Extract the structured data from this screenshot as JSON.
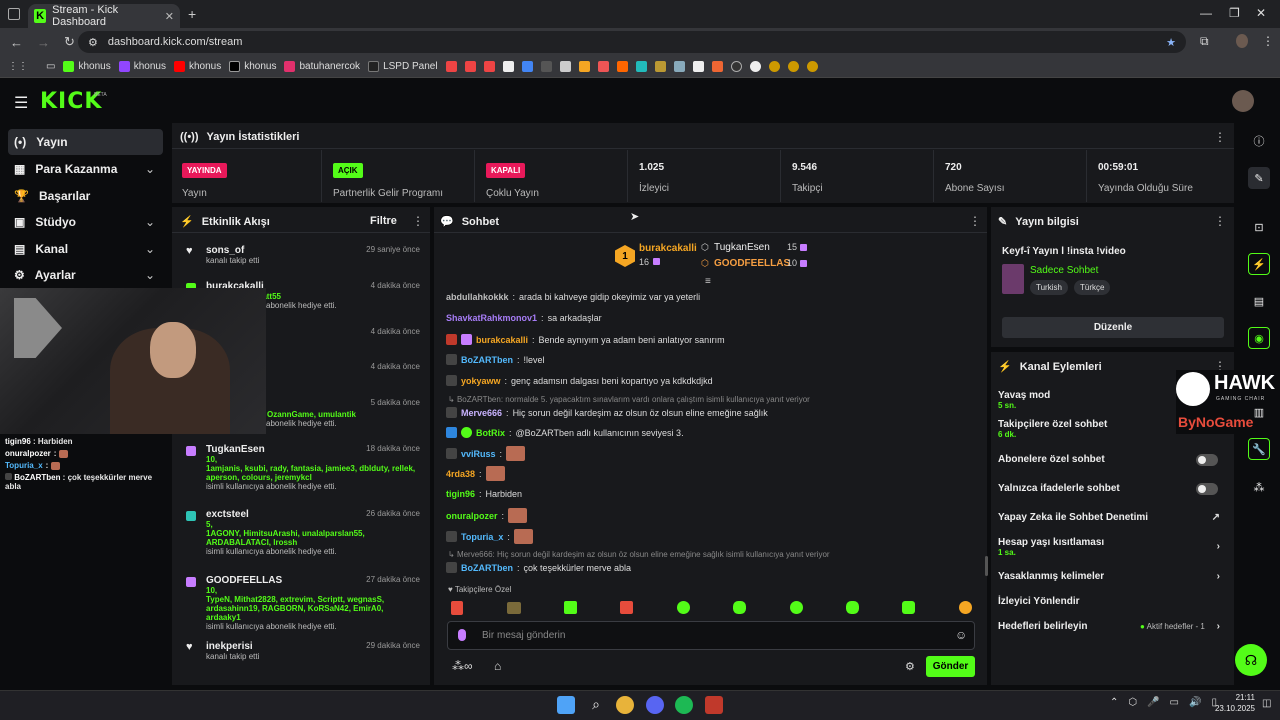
{
  "browser": {
    "tab_title": "Stream - Kick Dashboard",
    "tab_close": "✕",
    "new_tab": "+",
    "url": "dashboard.kick.com/stream",
    "bookmarks": [
      "khonus",
      "khonus",
      "khonus",
      "khonus",
      "batuhanercok",
      "LSPD Panel"
    ]
  },
  "header": {
    "logo": "KICK",
    "beta": "BETA"
  },
  "nav": [
    {
      "label": "Yayın",
      "icon": "(•)"
    },
    {
      "label": "Para Kazanma",
      "icon": "▦"
    },
    {
      "label": "Başarılar",
      "icon": "🏆"
    },
    {
      "label": "Stüdyo",
      "icon": "▣"
    },
    {
      "label": "Kanal",
      "icon": "▤"
    },
    {
      "label": "Ayarlar",
      "icon": "⚙"
    }
  ],
  "stats": {
    "title": "Yayın İstatistikleri",
    "items": [
      {
        "badge": "YAYINDA",
        "badge_color": "#e8195a",
        "label": "Yayın"
      },
      {
        "badge": "AÇIK",
        "badge_color": "#53fc18",
        "label": "Partnerlik Gelir Programı"
      },
      {
        "badge": "KAPALI",
        "badge_color": "#e8195a",
        "label": "Çoklu Yayın"
      },
      {
        "value": "1.025",
        "label": "İzleyici"
      },
      {
        "value": "9.546",
        "label": "Takipçi"
      },
      {
        "value": "720",
        "label": "Abone Sayısı"
      },
      {
        "value": "00:59:01",
        "label": "Yayında Olduğu Süre"
      }
    ]
  },
  "feed": {
    "title": "Etkinlik Akışı",
    "filter": "Filtre",
    "items": [
      {
        "name": "sons_of",
        "time": "29 saniye önce",
        "text": "kanalı takip etti"
      },
      {
        "name": "burakcakalli",
        "time": "4 dakika önce",
        "gift": "ur, TelaXi, ssrhatt55",
        "text": "isimli kullanıcıya abonelik hediye etti."
      },
      {
        "time": "4 dakika önce"
      },
      {
        "time": "4 dakika önce"
      },
      {
        "time": "5 dakika önce",
        "gift": "stere, Aermorn, OzannGame, umulantik",
        "text": "isimli kullanıcıya abonelik hediye etti."
      },
      {
        "name": "TugkanEsen",
        "time": "18 dakika önce",
        "count": "10,",
        "gift": "1amjanis, ksubi, rady, fantasia, jamiee3, dblduty, rellek, aperson, colours, jeremykcl",
        "text": "isimli kullanıcıya abonelik hediye etti."
      },
      {
        "name": "exctsteel",
        "time": "26 dakika önce",
        "count": "5,",
        "gift": "1AGONY, HimitsuArashi, unalalparslan55, ARDABALATACI, lrossh",
        "text": "isimli kullanıcıya abonelik hediye etti."
      },
      {
        "name": "GOODFEELLAS",
        "time": "27 dakika önce",
        "count": "10,",
        "gift": "TypeN, Mithat2828, extrevim, Scriptt, wegnasS, ardasahinn19, RAGBORN, KoRSaN42, EmirA0, ardaaky1",
        "text": "isimli kullanıcıya abonelik hediye etti."
      },
      {
        "name": "inekperisi",
        "time": "29 dakika önce",
        "text": "kanalı takip etti"
      }
    ]
  },
  "overlay_chat": [
    {
      "user": "tigin96",
      "text": "Harbiden"
    },
    {
      "user": "onuralpozer",
      "text": ""
    },
    {
      "user": "Topuria_x",
      "text": ""
    },
    {
      "user": "BoZARTben",
      "text": "çok teşekkürler merve abla"
    }
  ],
  "chat": {
    "title": "Sohbet",
    "top_gifter": {
      "rank": "1",
      "name": "burakcakalli",
      "count": "16"
    },
    "gifters": [
      {
        "name": "TugkanEsen",
        "count": "15"
      },
      {
        "name": "GOODFEELLAS",
        "count": "10"
      }
    ],
    "messages": [
      {
        "user": "abdullahkokkk",
        "color": "#bdbdbd",
        "text": "arada bi kahveye gidip okeyimiz var ya yeterli"
      },
      {
        "user": "ShavkatRahkmonov1",
        "color": "#a67cf5",
        "text": "sa arkadaşlar"
      },
      {
        "user": "burakcakalli",
        "color": "#f5a623",
        "text": "Bende aynıyım ya adam beni anlatıyor sanırım"
      },
      {
        "user": "BoZARTben",
        "color": "#53b9fc",
        "text": "!level"
      },
      {
        "user": "yokyaww",
        "color": "#f5a623",
        "text": "genç adamsın dalgası beni kopartıyo ya kdkdkdjkd"
      },
      {
        "user": "Merve666",
        "color": "#c9b3ff",
        "text": "Hiç sorun değil kardeşim az olsun öz olsun eline emeğine sağlık"
      },
      {
        "user": "BotRix",
        "color": "#53fc18",
        "text": "@BoZARTben adlı kullanıcının seviyesi 3."
      },
      {
        "user": "vviRuss",
        "color": "#53b9fc",
        "text": ""
      },
      {
        "user": "4rda38",
        "color": "#f5a623",
        "text": ""
      },
      {
        "user": "tigin96",
        "color": "#53fc18",
        "text": "Harbiden"
      },
      {
        "user": "onuralpozer",
        "color": "#53fc18",
        "text": ""
      },
      {
        "user": "Topuria_x",
        "color": "#53b9fc",
        "text": ""
      },
      {
        "user": "BoZARTben",
        "color": "#53b9fc",
        "text": "çok teşekkürler merve abla"
      }
    ],
    "reply1": "BoZARTben: normalde 5. yapacaktım sınavlarım vardı onlara çalıştım isimli kullanıcıya yanıt veriyor",
    "reply2": "Merve666: Hiç sorun değil kardeşim az olsun öz olsun eline emeğine sağlık isimli kullanıcıya yanıt veriyor",
    "emote_label": "Takipçilere Özel",
    "placeholder": "Bir mesaj gönderin",
    "send": "Gönder"
  },
  "stream_info": {
    "title": "Yayın bilgisi",
    "stream_title": "Keyf-î Yayın l !insta !video",
    "category": "Sadece Sohbet",
    "tags": [
      "Turkish",
      "Türkçe"
    ],
    "edit": "Düzenle"
  },
  "channel_actions": {
    "title": "Kanal Eylemleri",
    "rows": [
      {
        "label": "Yavaş mod",
        "sub": "5 sn."
      },
      {
        "label": "Takipçilere özel sohbet",
        "sub": "6 dk."
      },
      {
        "label": "Abonelere özel sohbet"
      },
      {
        "label": "Yalnızca ifadelerle sohbet"
      },
      {
        "label": "Yapay Zeka ile Sohbet Denetimi"
      },
      {
        "label": "Hesap yaşı kısıtlaması",
        "sub": "1 sa."
      },
      {
        "label": "Yasaklanmış kelimeler"
      },
      {
        "label": "İzleyici Yönlendir"
      },
      {
        "label": "Hedefleri belirleyin",
        "status": "Aktif hedefler - 1"
      }
    ]
  },
  "overlay_brand": {
    "hawk": "HAWK",
    "hawk_sub": "GAMING CHAIR",
    "bynogame": "ByNoGame"
  },
  "taskbar": {
    "time": "21:11",
    "date": "23.10.2025"
  }
}
